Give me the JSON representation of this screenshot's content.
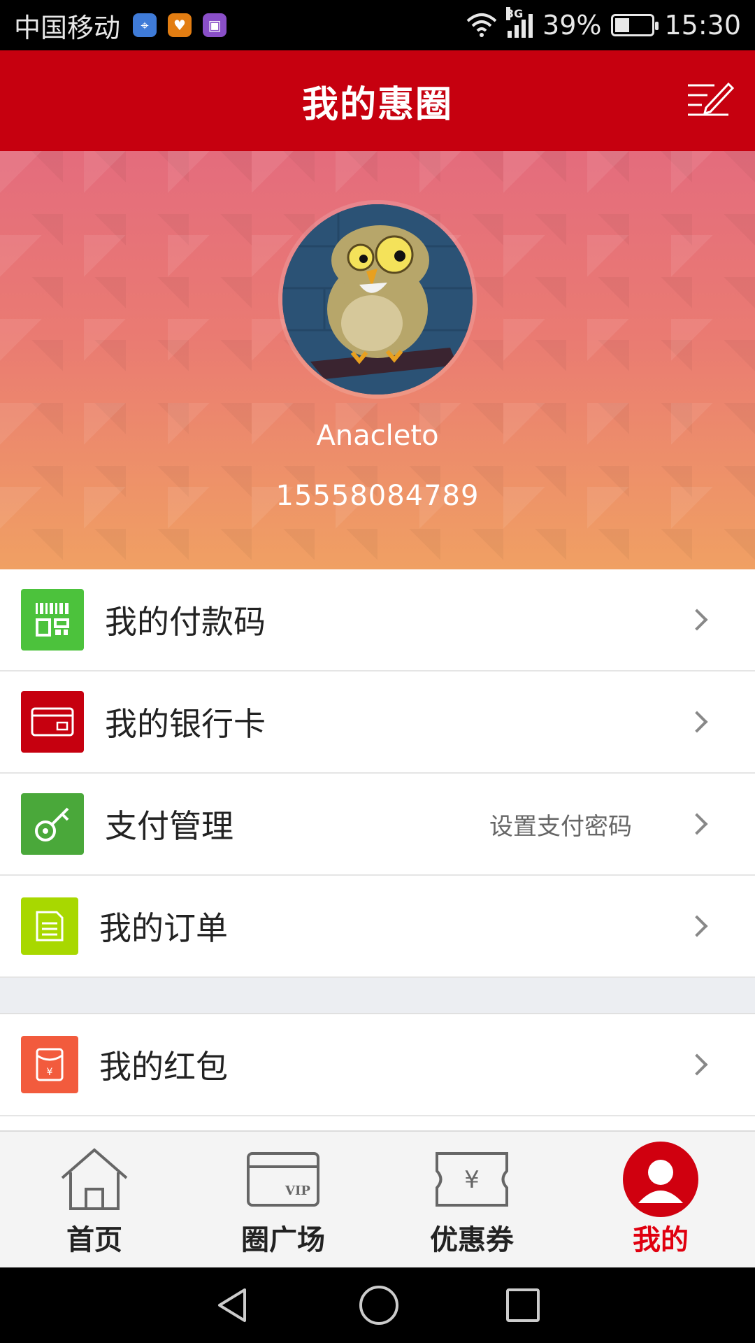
{
  "status_bar": {
    "carrier": "中国移动",
    "network": "3G",
    "battery": "39%",
    "battery_level": 0.39,
    "time": "15:30"
  },
  "header": {
    "title": "我的惠圈"
  },
  "profile": {
    "name": "Anacleto",
    "phone": "15558084789"
  },
  "menu": {
    "items": [
      {
        "label": "我的付款码",
        "hint": "",
        "icon": "barcode-icon",
        "color": "#4cc23c"
      },
      {
        "label": "我的银行卡",
        "hint": "",
        "icon": "bank-card-icon",
        "color": "#c6000f"
      },
      {
        "label": "支付管理",
        "hint": "设置支付密码",
        "icon": "key-icon",
        "color": "#4aa83a"
      },
      {
        "label": "我的订单",
        "hint": "",
        "icon": "document-icon",
        "color": "#a8d800"
      },
      {
        "label": "我的红包",
        "hint": "",
        "icon": "red-envelope-icon",
        "color": "#f25b3d"
      }
    ]
  },
  "tabs": [
    {
      "label": "首页",
      "icon": "home-icon",
      "active": false
    },
    {
      "label": "圈广场",
      "icon": "vip-card-icon",
      "active": false
    },
    {
      "label": "优惠券",
      "icon": "coupon-icon",
      "active": false
    },
    {
      "label": "我的",
      "icon": "user-icon",
      "active": true
    }
  ],
  "colors": {
    "brand_red": "#c6000f",
    "active_tab": "#e0000f"
  }
}
